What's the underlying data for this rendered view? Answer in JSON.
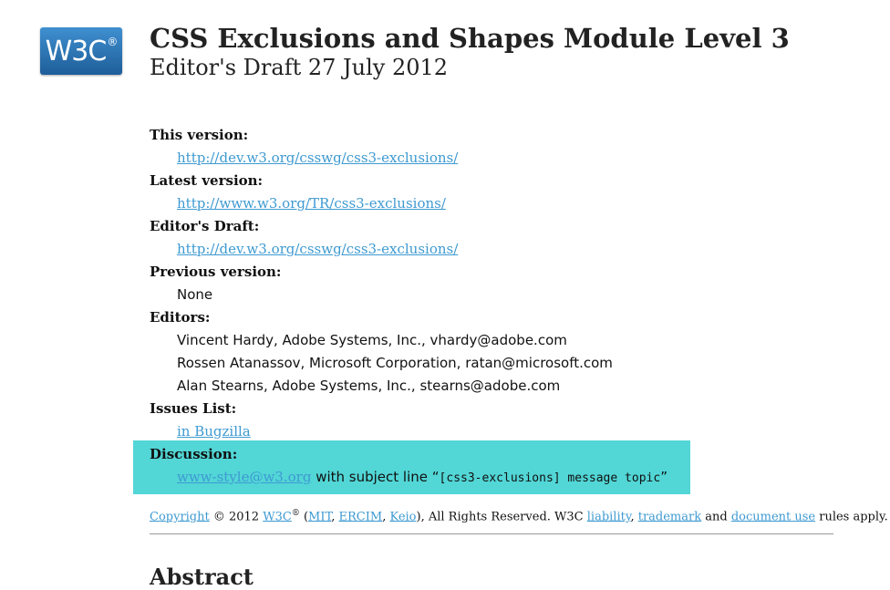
{
  "logo": {
    "text": "W3C",
    "mark": "®"
  },
  "title": "CSS Exclusions and Shapes Module Level 3",
  "subtitle": "Editor's Draft 27 July 2012",
  "this_version": {
    "label": "This version:",
    "link": "http://dev.w3.org/csswg/css3-exclusions/"
  },
  "latest_version": {
    "label": "Latest version:",
    "link": "http://www.w3.org/TR/css3-exclusions/"
  },
  "editors_draft": {
    "label": "Editor's Draft:",
    "link": "http://dev.w3.org/csswg/css3-exclusions/"
  },
  "previous_version": {
    "label": "Previous version:",
    "value": "None"
  },
  "editors": {
    "label": "Editors:",
    "items": [
      "Vincent Hardy, Adobe Systems, Inc., vhardy@adobe.com",
      "Rossen Atanassov, Microsoft Corporation, ratan@microsoft.com",
      "Alan Stearns, Adobe Systems, Inc., stearns@adobe.com"
    ]
  },
  "issues_list": {
    "label": "Issues List:",
    "link": "in Bugzilla"
  },
  "discussion": {
    "label": "Discussion:",
    "link": "www-style@w3.org",
    "text": " with subject line ",
    "quote_open": "“",
    "code": "[css3-exclusions] message topic",
    "quote_close": "”",
    "highlight_color": "#52d6d6"
  },
  "copyright": {
    "link_copyright": "Copyright",
    "text1": " © 2012 ",
    "link_w3c": "W3C",
    "reg": "®",
    "text2": " (",
    "link_mit": "MIT",
    "sep1": ", ",
    "link_ercim": "ERCIM",
    "sep2": ", ",
    "link_keio": "Keio",
    "text3": "), All Rights Reserved. W3C ",
    "link_liability": "liability",
    "sep3": ", ",
    "link_trademark": "trademark",
    "text4": " and ",
    "link_document_use": "document use",
    "text5": " rules apply."
  },
  "abstract_heading": "Abstract",
  "colors": {
    "link": "#3e9ad2",
    "logo": "#2b74b8"
  }
}
